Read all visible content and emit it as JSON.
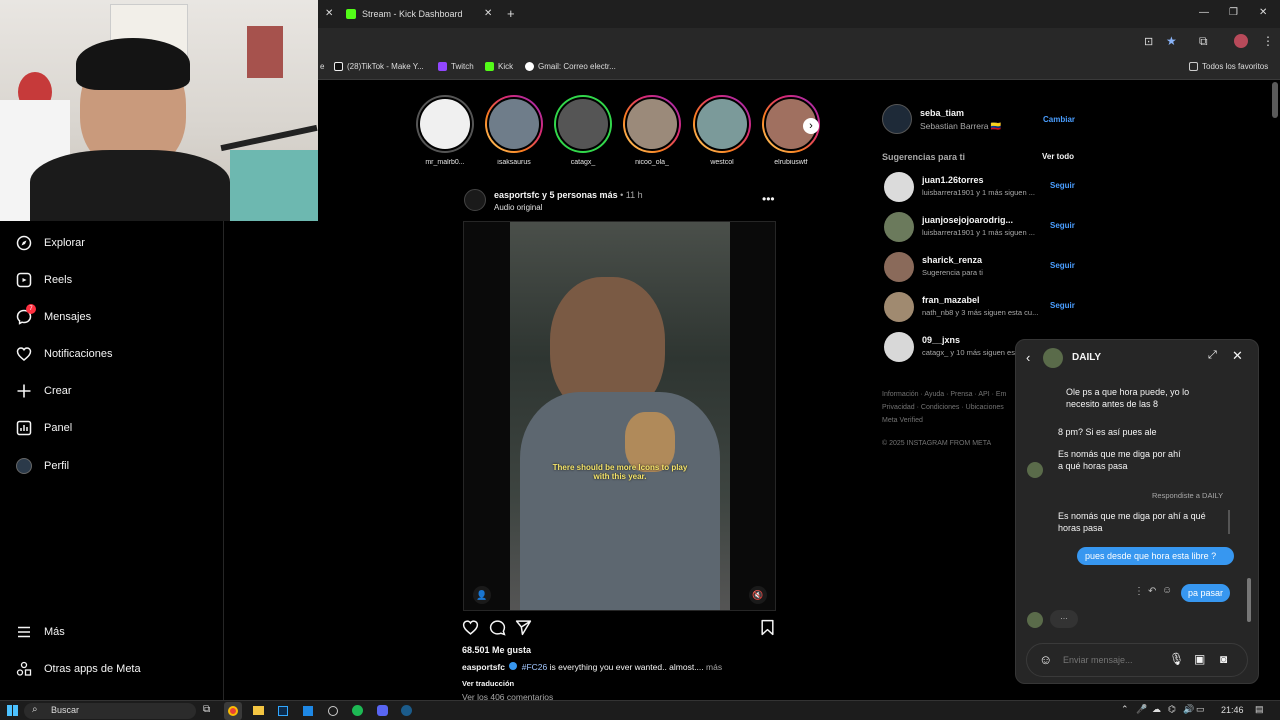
{
  "browser": {
    "tabs": [
      {
        "label": "Stream - Kick Dashboard"
      }
    ],
    "new_tab": "+",
    "bookmarks": [
      {
        "label": "e"
      },
      {
        "label": "(28)TikTok - Make Y..."
      },
      {
        "label": "Twitch"
      },
      {
        "label": "Kick"
      },
      {
        "label": "Gmail: Correo electr..."
      }
    ],
    "all_bookmarks": "Todos los favoritos"
  },
  "sidebar": {
    "items": [
      {
        "label": "Explorar",
        "icon": "compass-icon"
      },
      {
        "label": "Reels",
        "icon": "reels-icon"
      },
      {
        "label": "Mensajes",
        "icon": "messenger-icon",
        "badge": "7"
      },
      {
        "label": "Notificaciones",
        "icon": "heart-icon"
      },
      {
        "label": "Crear",
        "icon": "plus-icon"
      },
      {
        "label": "Panel",
        "icon": "dashboard-icon"
      },
      {
        "label": "Perfil",
        "icon": "avatar-icon"
      }
    ],
    "more": "Más",
    "meta_apps": "Otras apps de Meta"
  },
  "stories": [
    {
      "name": "mr_malrb0...",
      "ring": "seen"
    },
    {
      "name": "isaksaurus",
      "ring": "new"
    },
    {
      "name": "catagx_",
      "ring": "green"
    },
    {
      "name": "nicoo_ola_",
      "ring": "new"
    },
    {
      "name": "westcol",
      "ring": "new"
    },
    {
      "name": "elrubiuswtf",
      "ring": "new"
    }
  ],
  "post": {
    "author": "easportsfc",
    "coauthors": " y 5 personas más",
    "time": " • 11 h",
    "audio": "Audio original",
    "overlay_text": "There should be more Icons to play with this year.",
    "likes": "68.501 Me gusta",
    "caption_user": "easportsfc",
    "hashtag": "#FC26",
    "caption_text": " is everything you ever wanted.. almost....",
    "more": " más",
    "translate": "Ver traducción",
    "comments": "Ver los 406 comentarios"
  },
  "profile": {
    "username": "seba_tiam",
    "name": "Sebastian Barrera 🇨🇴",
    "switch": "Cambiar"
  },
  "suggestions": {
    "title": "Sugerencias para ti",
    "see_all": "Ver todo",
    "follow": "Seguir",
    "items": [
      {
        "user": "juan1.26torres",
        "sub": "luisbarrera1901 y 1 más siguen ..."
      },
      {
        "user": "juanjosejojoarodrig...",
        "sub": "luisbarrera1901 y 1 más siguen ..."
      },
      {
        "user": "sharick_renza",
        "sub": "Sugerencia para ti"
      },
      {
        "user": "fran_mazabel",
        "sub": "nath_nb8 y 3 más siguen esta cu..."
      },
      {
        "user": "09__jxns",
        "sub": "catagx_ y 10 más siguen es..."
      }
    ]
  },
  "footer": {
    "links1": "Información · Ayuda · Prensa · API · Em",
    "links2": "Privacidad · Condiciones · Ubicaciones",
    "links3": "Meta Verified",
    "copyright": "© 2025 INSTAGRAM FROM META"
  },
  "chat": {
    "title": "DAILY",
    "messages": [
      {
        "text": "Ole ps a que hora puede, yo lo necesito antes de las 8"
      },
      {
        "text": "8 pm? Si es así pues ale"
      },
      {
        "text": "Es nomás que me diga por ahí a qué horas pasa"
      },
      {
        "reply_label": "Respondiste a DAILY"
      },
      {
        "text": "Es nomás que me diga por ahí a qué horas pasa"
      },
      {
        "text": "pues desde que hora esta libre ?"
      },
      {
        "text": "pa pasar"
      },
      {
        "text": "..."
      }
    ],
    "input_placeholder": "Enviar mensaje..."
  },
  "taskbar": {
    "search": "Buscar",
    "time": "21:46"
  },
  "colors": {
    "accent_blue": "#3797f0",
    "link_blue": "#4a9eff",
    "badge_red": "#ff3040",
    "bg": "#000000"
  }
}
